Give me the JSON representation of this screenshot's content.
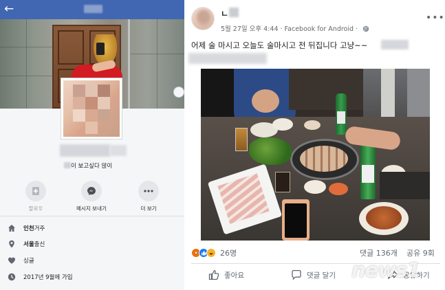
{
  "profile": {
    "tagline_suffix": "이 보고싶다 많이",
    "actions": [
      {
        "label": "팔로우",
        "icon": "follow-icon"
      },
      {
        "label": "메시지 보내기",
        "icon": "messenger-icon"
      },
      {
        "label": "더 보기",
        "icon": "more-icon"
      }
    ],
    "intro": {
      "lives_bold": "인천",
      "lives_rest": " 거주",
      "from_bold": "서울",
      "from_rest": " 출신",
      "relationship": "싱글",
      "joined": "2017년 9월에 가입"
    }
  },
  "post": {
    "timestamp": "5월 27일 오후 4:44",
    "source": " · Facebook for Android · ",
    "text_line1": "어제 술 마시고 오늘도 술마시고 전 뒤집니다 고냥~~",
    "reactions_count": "26명",
    "comments": "댓글 136개",
    "shares": "공유 9회",
    "like_label": "좋아요",
    "comment_label": "댓글 달기",
    "share_label": "공유하기"
  },
  "watermark": "news1",
  "colors": {
    "facebook_blue": "#4267b2",
    "like_blue": "#1877f2",
    "haha_yellow": "#f7b125",
    "angry_orange": "#e9710f"
  }
}
